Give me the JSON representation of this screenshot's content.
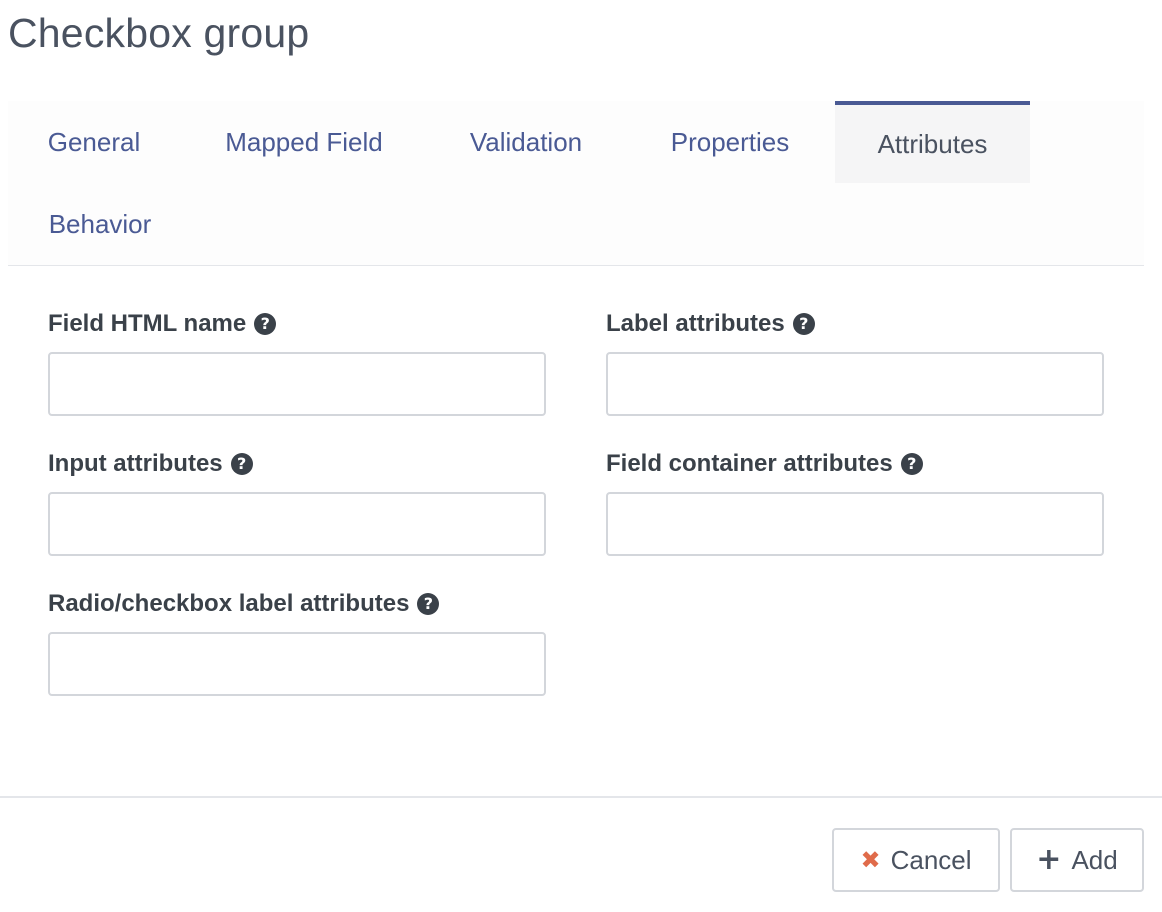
{
  "modal": {
    "title": "Checkbox group"
  },
  "tabs": [
    {
      "label": "General",
      "active": false
    },
    {
      "label": "Mapped Field",
      "active": false
    },
    {
      "label": "Validation",
      "active": false
    },
    {
      "label": "Properties",
      "active": false
    },
    {
      "label": "Attributes",
      "active": true
    },
    {
      "label": "Behavior",
      "active": false
    }
  ],
  "fields": {
    "field_html_name": {
      "label": "Field HTML name",
      "value": "",
      "help_icon": "question-circle-icon"
    },
    "label_attributes": {
      "label": "Label attributes",
      "value": "",
      "help_icon": "question-circle-icon"
    },
    "input_attributes": {
      "label": "Input attributes",
      "value": "",
      "help_icon": "question-circle-icon"
    },
    "field_container_attributes": {
      "label": "Field container attributes",
      "value": "",
      "help_icon": "question-circle-icon"
    },
    "radio_checkbox_label_attributes": {
      "label": "Radio/checkbox label attributes",
      "value": "",
      "help_icon": "question-circle-icon"
    }
  },
  "footer": {
    "cancel_label": "Cancel",
    "cancel_icon": "close-icon",
    "add_label": "Add",
    "add_icon": "plus-icon"
  },
  "colors": {
    "accent": "#4a5a94",
    "cancel_icon": "#e06b4a"
  }
}
